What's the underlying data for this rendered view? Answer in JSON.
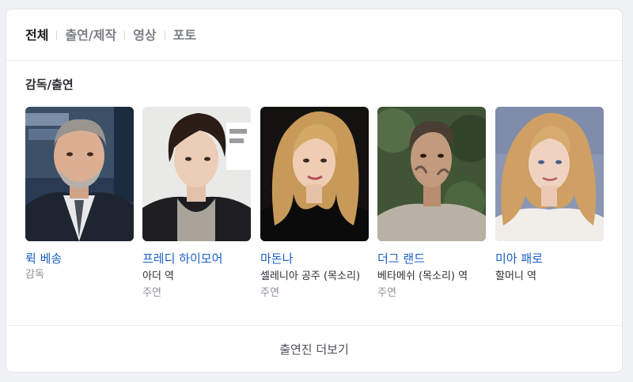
{
  "tabs": [
    {
      "label": "전체",
      "active": true
    },
    {
      "label": "출연/제작",
      "active": false
    },
    {
      "label": "영상",
      "active": false
    },
    {
      "label": "포토",
      "active": false
    }
  ],
  "section": {
    "title": "감독/출연"
  },
  "people": [
    {
      "name": "뤽 베송",
      "role": "감독",
      "type": ""
    },
    {
      "name": "프레디 하이모어",
      "role": "아더 역",
      "type": "주연"
    },
    {
      "name": "마돈나",
      "role": "셀레니아 공주 (목소리)",
      "type": "주연"
    },
    {
      "name": "더그 랜드",
      "role": "베타메쉬 (목소리) 역",
      "type": "주연"
    },
    {
      "name": "미아 패로",
      "role": "할머니 역",
      "type": ""
    }
  ],
  "more": {
    "label": "출연진 더보기"
  },
  "colors": {
    "link": "#1a5fc4",
    "background": "#eff1f4",
    "card": "#ffffff",
    "muted": "#8d9096"
  }
}
